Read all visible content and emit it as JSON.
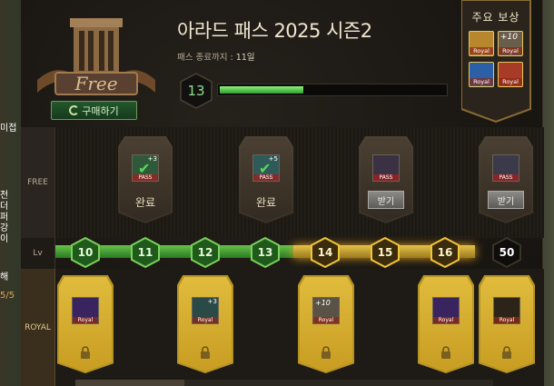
{
  "side_strip": {
    "left_text": [
      "미접",
      "전",
      "더",
      "퍼",
      "강",
      "이",
      "해",
      "5/5"
    ]
  },
  "header": {
    "emblem_label": "Free",
    "buy_label": "구매하기",
    "title": "아라드 패스 2025 시즌2",
    "remaining_label": "패스 종료까지 :",
    "remaining_value": "11일",
    "current_level": "13",
    "level_progress": 0.37
  },
  "rewards_panel": {
    "title": "주요 보상",
    "items": [
      {
        "icon": "golden-scroll-icon",
        "tag": "Royal",
        "color": "#e0b53a"
      },
      {
        "icon": "plus10-enhance-icon",
        "tag": "Royal",
        "overlay": "+10",
        "color": "#c9c3b8"
      },
      {
        "icon": "blue-gem-icon",
        "tag": "Royal",
        "color": "#3f8ad8"
      },
      {
        "icon": "red-card-icon",
        "tag": "Royal",
        "color": "#d84a34"
      }
    ]
  },
  "rows": {
    "free": "FREE",
    "lv": "Lv",
    "royal": "ROYAL"
  },
  "free_rewards": [
    {
      "level": "11",
      "state": "claimed",
      "label": "완료",
      "item_tag": "PASS",
      "item_overlay": "+3"
    },
    {
      "level": "13",
      "state": "claimed",
      "label": "완료",
      "item_tag": "PASS",
      "item_overlay": "+5"
    },
    {
      "level": "15",
      "state": "claimable",
      "label": "받기",
      "item_tag": "PASS"
    },
    {
      "level": "50",
      "state": "claimable",
      "label": "받기",
      "item_tag": "PASS"
    }
  ],
  "levels": [
    {
      "value": "10",
      "reached": true
    },
    {
      "value": "11",
      "reached": true
    },
    {
      "value": "12",
      "reached": true
    },
    {
      "value": "13",
      "reached": true
    },
    {
      "value": "14",
      "reached": false
    },
    {
      "value": "15",
      "reached": false
    },
    {
      "value": "16",
      "reached": false
    },
    {
      "value": "50",
      "reached": false
    }
  ],
  "royal_rewards": [
    {
      "level": "10",
      "item_tag": "Royal",
      "item": "purple-box-icon"
    },
    {
      "level": "12",
      "item_tag": "Royal",
      "item": "green-potion-icon",
      "item_overlay": "+3"
    },
    {
      "level": "14",
      "item_tag": "Royal",
      "item": "plus10-enhance-icon",
      "item_overlay": "+10"
    },
    {
      "level": "16",
      "item_tag": "Royal",
      "item": "purple-box-icon"
    },
    {
      "level": "50",
      "item_tag": "Royal",
      "item": "dark-chest-icon"
    }
  ]
}
